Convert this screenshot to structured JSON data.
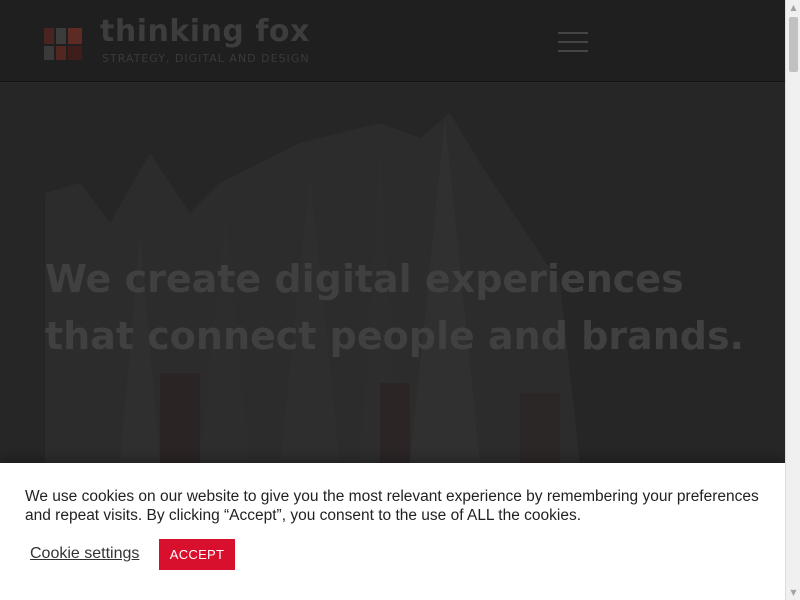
{
  "header": {
    "logo_name": "thinking fox",
    "logo_tagline": "STRATEGY, DIGITAL AND DESIGN",
    "menu_icon": "hamburger-menu-icon",
    "logo_colors": [
      "#5a2a22",
      "#4a1e1a",
      "#3a3a3a",
      "#6b3328"
    ]
  },
  "hero": {
    "title": "We create digital experiences that connect people and brands."
  },
  "cookie_banner": {
    "message": "We use cookies on our website to give you the most relevant experience by remembering your preferences and repeat visits. By clicking “Accept”, you consent to the use of ALL the cookies.",
    "settings_label": "Cookie settings",
    "accept_label": "ACCEPT",
    "accent_color": "#d8102e"
  },
  "scrollbar": {
    "up_icon": "scroll-up-arrow-icon",
    "down_icon": "scroll-down-arrow-icon"
  }
}
